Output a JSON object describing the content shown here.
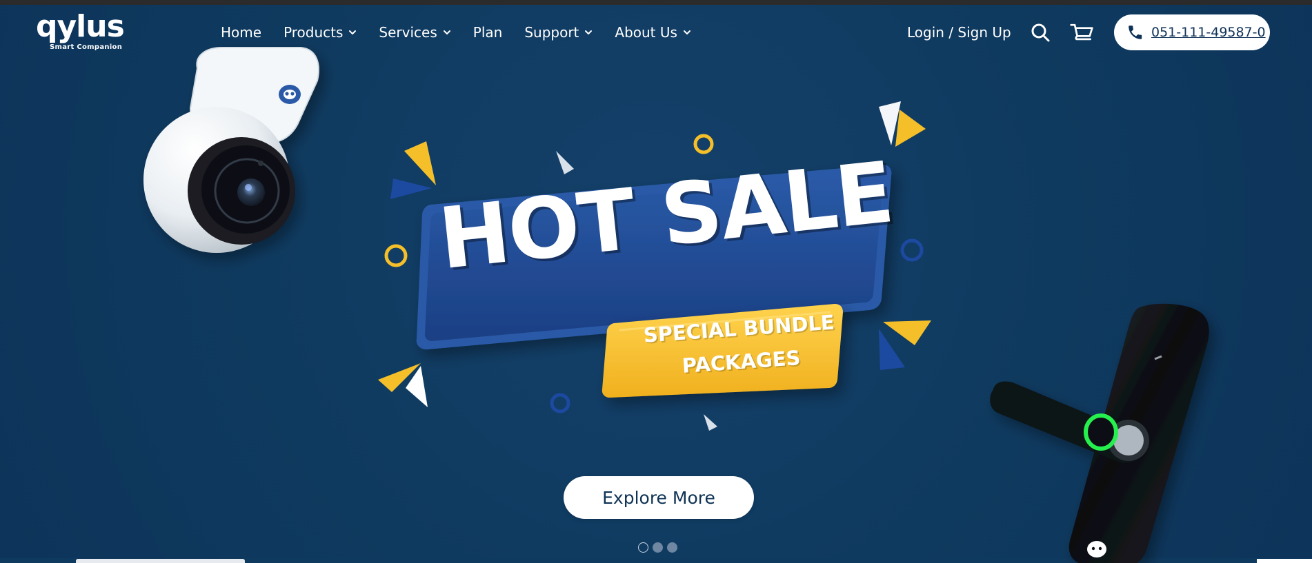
{
  "brand": {
    "logo_text": "qylus",
    "tagline": "Smart Companion"
  },
  "nav": {
    "items": [
      {
        "label": "Home",
        "has_dropdown": false
      },
      {
        "label": "Products",
        "has_dropdown": true
      },
      {
        "label": "Services",
        "has_dropdown": true
      },
      {
        "label": "Plan",
        "has_dropdown": false
      },
      {
        "label": "Support",
        "has_dropdown": true
      },
      {
        "label": "About Us",
        "has_dropdown": true
      }
    ],
    "login_label": "Login / Sign Up",
    "search_icon": "search-icon",
    "cart_icon": "cart-icon",
    "phone": "051-111-49587-0",
    "phone_icon": "phone-icon"
  },
  "hero": {
    "headline": "HOT SALE",
    "subline": "SPECIAL BUNDLE PACKAGES",
    "cta_label": "Explore More",
    "slides": 3,
    "active_slide": 1
  },
  "colors": {
    "background": "#0f3a5f",
    "banner_blue": "#1b4a94",
    "banner_yellow": "#f5bf2a",
    "white": "#ffffff",
    "text_dark": "#0f3355"
  }
}
